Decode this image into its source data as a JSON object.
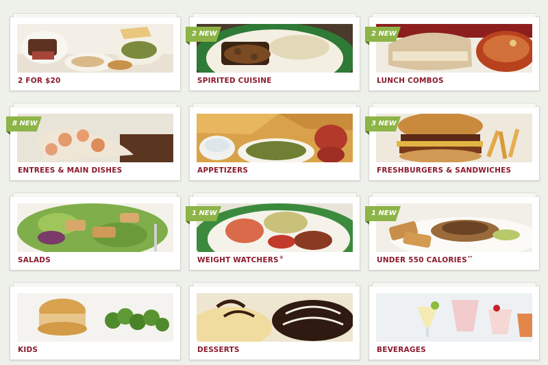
{
  "menu": {
    "categories": [
      {
        "label": "2 FOR $20",
        "badge": ""
      },
      {
        "label": "SPIRITED CUISINE",
        "badge": "2 NEW"
      },
      {
        "label": "LUNCH COMBOS",
        "badge": "2 NEW"
      },
      {
        "label": "ENTREES & MAIN DISHES",
        "badge": "8 NEW"
      },
      {
        "label": "APPETIZERS",
        "badge": ""
      },
      {
        "label": "FRESHBURGERS & SANDWICHES",
        "badge": "3 NEW"
      },
      {
        "label": "SALADS",
        "badge": ""
      },
      {
        "label": "WEIGHT WATCHERS",
        "mark": "®",
        "badge": "1 NEW"
      },
      {
        "label": "UNDER 550 CALORIES",
        "mark": "**",
        "badge": "1 NEW"
      },
      {
        "label": "KIDS",
        "badge": ""
      },
      {
        "label": "DESSERTS",
        "badge": ""
      },
      {
        "label": "BEVERAGES",
        "badge": ""
      }
    ]
  },
  "colors": {
    "background": "#eef0ea",
    "label_text": "#8a1a2c",
    "badge": "#8db447"
  }
}
